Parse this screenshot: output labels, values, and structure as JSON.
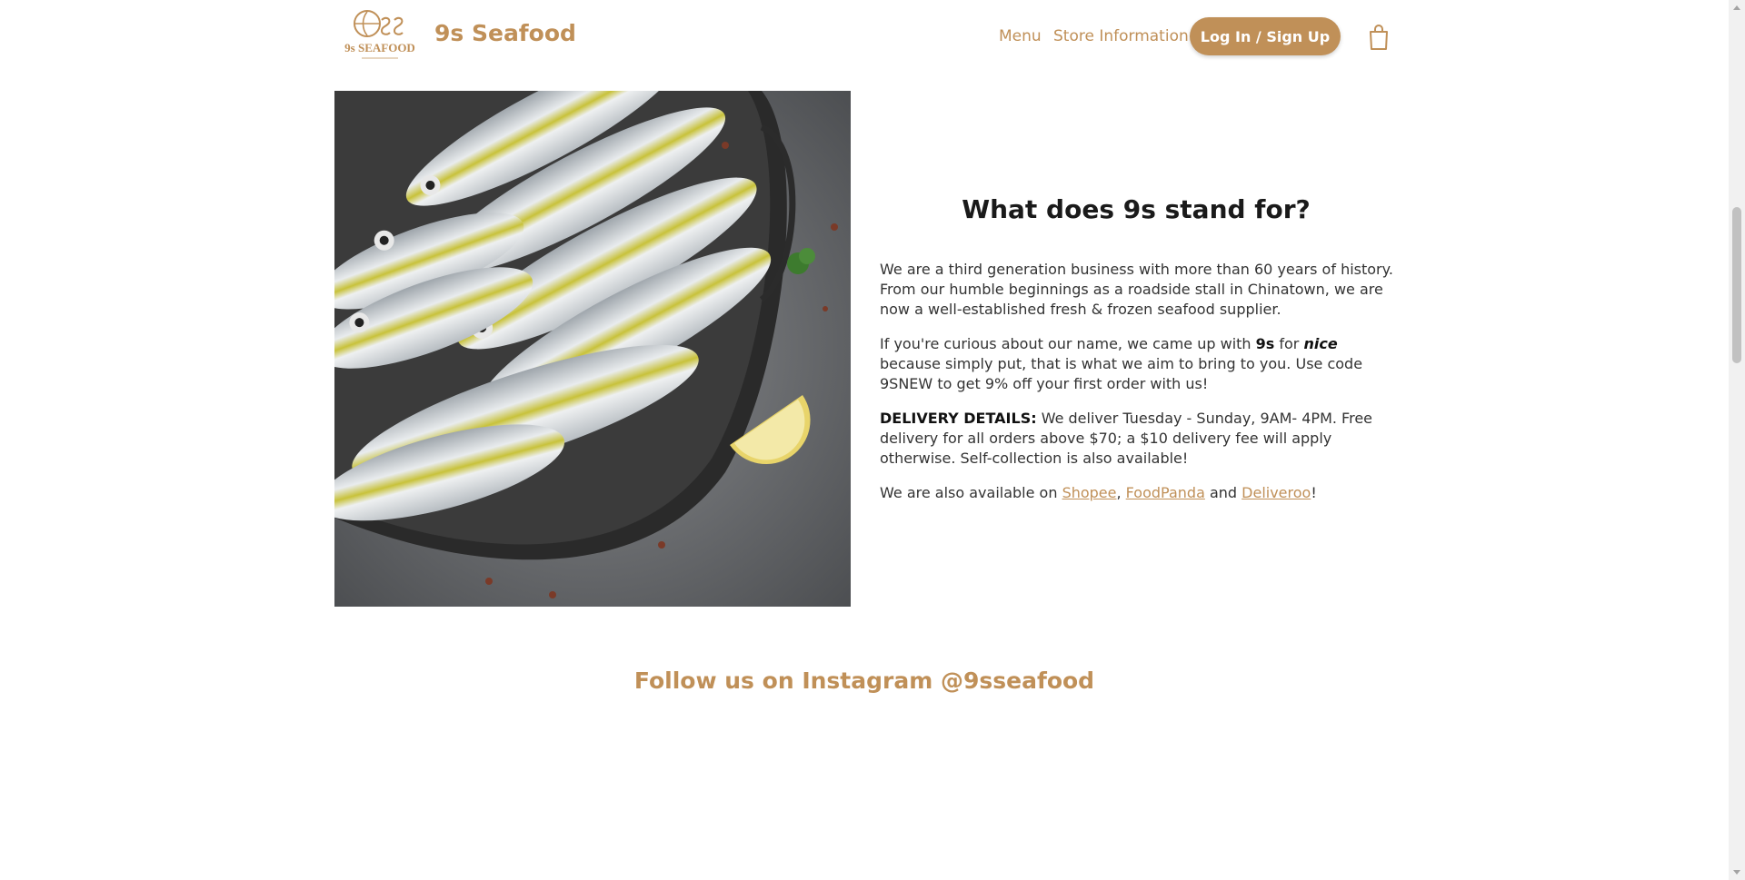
{
  "header": {
    "logo_text": "9s SEAFOOD",
    "brand": "9s Seafood",
    "nav": {
      "menu": "Menu",
      "store": "Store Information"
    },
    "login_label": "Log In / Sign Up"
  },
  "about": {
    "title": "What does 9s stand for?",
    "p1": "We are a third generation business with more than 60 years of history. From our humble beginnings as a roadside stall in Chinatown, we are now a well-established fresh & frozen seafood supplier.",
    "p2": {
      "a": "If you're curious about our name, we came up with ",
      "b": "9s",
      "c": " for ",
      "d": "nice",
      "e": " because simply put, that is what we aim to bring to you. Use code 9SNEW to get 9% off your first order with us!"
    },
    "p3": {
      "label": "DELIVERY DETAILS:",
      "text": " We deliver Tuesday - Sunday, 9AM- 4PM. Free delivery for all orders above $70; a $10 delivery fee will apply otherwise. Self-collection is also available!"
    },
    "p4": {
      "prefix": "We are also available on ",
      "shopee": "Shopee",
      "sep1": ", ",
      "foodpanda": "FoodPanda",
      "sep2": " and ",
      "deliveroo": "Deliveroo",
      "suffix": "!"
    }
  },
  "instagram": {
    "heading": "Follow us on Instagram @9sseafood"
  },
  "colors": {
    "brand": "#c09058",
    "heading": "#1a1a1a",
    "body": "#333333"
  },
  "icons": {
    "cart": "shopping-bag-icon",
    "photo": "fish-platter-image"
  }
}
